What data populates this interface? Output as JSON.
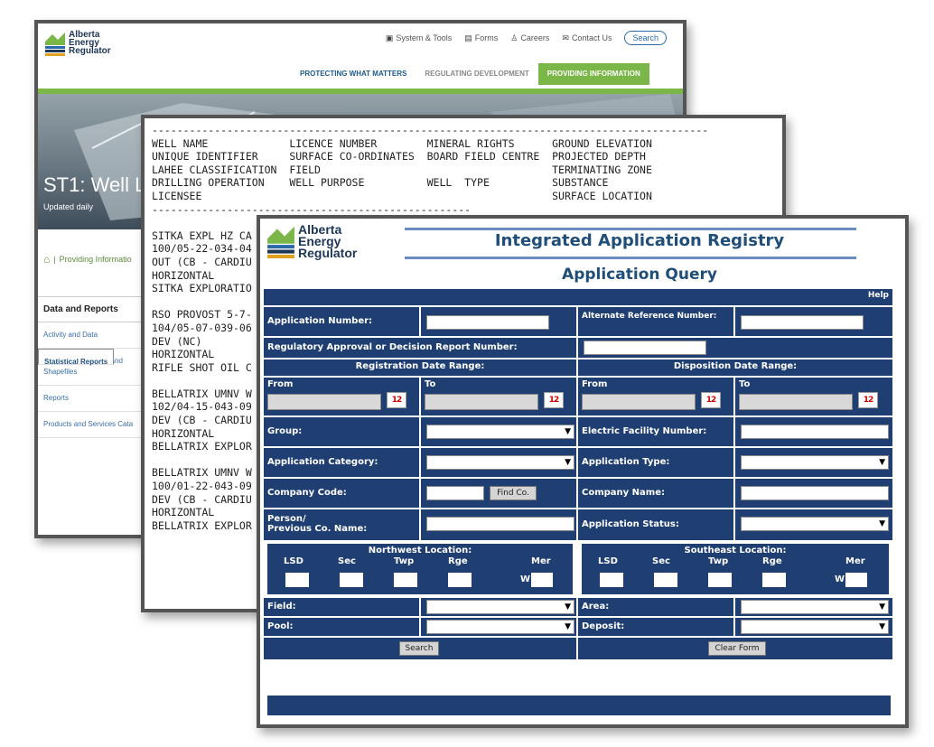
{
  "website": {
    "logo_text": [
      "Alberta",
      "Energy",
      "Regulator"
    ],
    "top_links": [
      {
        "icon": "briefcase-icon",
        "label": "System & Tools"
      },
      {
        "icon": "document-icon",
        "label": "Forms"
      },
      {
        "icon": "person-icon",
        "label": "Careers"
      },
      {
        "icon": "envelope-icon",
        "label": "Contact Us"
      }
    ],
    "search_label": "Search",
    "main_nav": [
      "PROTECTING WHAT MATTERS",
      "REGULATING DEVELOPMENT",
      "PROVIDING INFORMATION"
    ],
    "hero_title": "ST1: Well L",
    "hero_subtitle": "Updated daily",
    "breadcrumb": "Providing Informatio",
    "sidebar_heading": "Data and Reports",
    "sidebar_items": [
      "Activity and Data",
      "Statistical Reports",
      "Maps, Map Viewers, and Shapefiles",
      "Reports",
      "Products and Services Cata"
    ],
    "accent_color": "#7ab648",
    "brand_color": "#1d3557"
  },
  "well_listing": {
    "text": "-----------------------------------------------------------------------------------------\nWELL NAME             LICENCE NUMBER        MINERAL RIGHTS      GROUND ELEVATION\nUNIQUE IDENTIFIER     SURFACE CO-ORDINATES  BOARD FIELD CENTRE  PROJECTED DEPTH\nLAHEE CLASSIFICATION  FIELD                                     TERMINATING ZONE\nDRILLING OPERATION    WELL PURPOSE          WELL  TYPE          SUBSTANCE\nLICENSEE                                                        SURFACE LOCATION\n---------------------------------------------------\n\nSITKA EXPL HZ CA\n100/05-22-034-04\nOUT (CB - CARDIU\nHORIZONTAL\nSITKA EXPLORATIO\n\nRSO PROVOST 5-7-\n104/05-07-039-06\nDEV (NC)\nHORIZONTAL\nRIFLE SHOT OIL C\n\nBELLATRIX UMNV W\n102/04-15-043-09\nDEV (CB - CARDIU\nHORIZONTAL\nBELLATRIX EXPLOR\n\nBELLATRIX UMNV W\n100/01-22-043-09\nDEV (CB - CARDIU\nHORIZONTAL\nBELLATRIX EXPLOR"
  },
  "registry": {
    "logo_text": [
      "Alberta",
      "Energy",
      "Regulator"
    ],
    "title": "Integrated Application Registry",
    "subtitle": "Application Query",
    "help": "Help",
    "application_number": "Application Number:",
    "alternate_reference": "Alternate Reference Number:",
    "regulatory_approval": "Regulatory Approval or Decision Report Number:",
    "registration_range": "Registration Date Range:",
    "disposition_range": "Disposition Date Range:",
    "from": "From",
    "to": "To",
    "calendar_label": "12",
    "group": "Group:",
    "electric_facility": "Electric Facility Number:",
    "application_category": "Application Category:",
    "application_type": "Application Type:",
    "company_code": "Company Code:",
    "find_company": "Find Co.",
    "company_name": "Company Name:",
    "person_prev_1": "Person/",
    "person_prev_2": "Previous Co. Name:",
    "application_status": "Application Status:",
    "northwest_location": "Northwest Location:",
    "southeast_location": "Southeast Location:",
    "loc_cols": [
      "LSD",
      "Sec",
      "Twp",
      "Rge",
      "Mer"
    ],
    "mer_prefix": "W",
    "field": "Field:",
    "area": "Area:",
    "pool": "Pool:",
    "deposit": "Deposit:",
    "search_button": "Search",
    "clear_button": "Clear Form",
    "dropdown_arrow": "▼",
    "header_color": "#1f3f73",
    "title_color": "#1f4e79"
  }
}
